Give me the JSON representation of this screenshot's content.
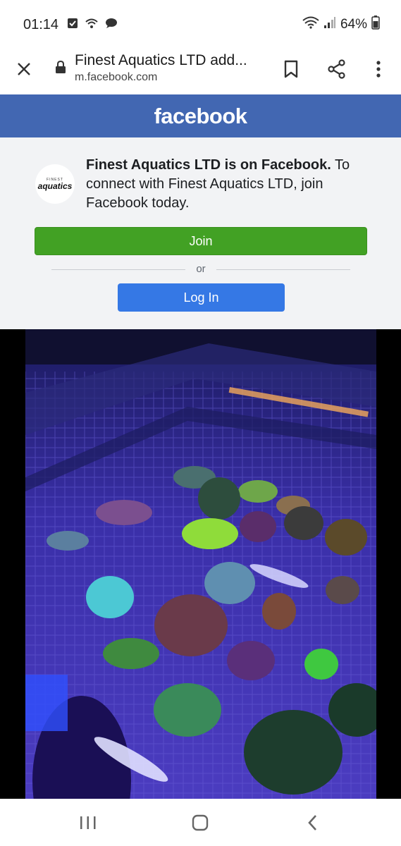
{
  "status_bar": {
    "time": "01:14",
    "battery": "64%"
  },
  "browser": {
    "title": "Finest Aquatics LTD add...",
    "url": "m.facebook.com"
  },
  "fb_header": {
    "logo_text": "facebook",
    "color": "#4267b2"
  },
  "promo": {
    "avatar_small": "FINEST",
    "avatar_main": "aquatics",
    "headline": "Finest Aquatics LTD is on Facebook.",
    "body": " To connect with Finest Aquatics LTD, join Facebook today.",
    "join_label": "Join",
    "or_label": "or",
    "login_label": "Log In",
    "join_color": "#42a124",
    "login_color": "#3578e5"
  },
  "photo": {
    "subject": "coral-frag-tank-photo"
  },
  "icons": [
    "close-icon",
    "lock-icon",
    "bookmark-icon",
    "share-icon",
    "more-menu-icon",
    "recents-icon",
    "home-icon",
    "back-icon"
  ]
}
